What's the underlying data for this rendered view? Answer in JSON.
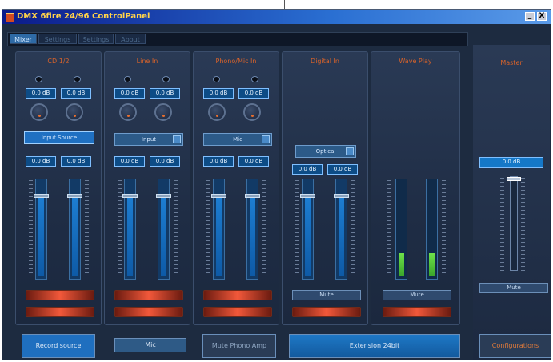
{
  "window": {
    "title": "DMX 6fire 24/96 ControlPanel",
    "minimize_label": "_",
    "close_label": "X"
  },
  "tabs": [
    {
      "label": "Mixer",
      "active": true
    },
    {
      "label": "Settings",
      "active": false
    },
    {
      "label": "Settings",
      "active": false
    },
    {
      "label": "About",
      "active": false
    }
  ],
  "strips": [
    {
      "name": "CD 1/2",
      "gain_left": "0.0 dB",
      "gain_right": "0.0 dB",
      "select": "Input Source",
      "level_left": "0.0 dB",
      "level_right": "0.0 dB",
      "fader_level": 0.85,
      "bottom_button": "Record source"
    },
    {
      "name": "Line In",
      "gain_left": "0.0 dB",
      "gain_right": "0.0 dB",
      "select": "Input",
      "level_left": "0.0 dB",
      "level_right": "0.0 dB",
      "fader_level": 0.85,
      "bottom_button": "Mic"
    },
    {
      "name": "Phono/Mic In",
      "gain_left": "0.0 dB",
      "gain_right": "0.0 dB",
      "select": "Mic",
      "level_left": "0.0 dB",
      "level_right": "0.0 dB",
      "fader_level": 0.85,
      "bottom_button": "Mute Phono Amp"
    },
    {
      "name": "Digital In",
      "select": "Optical",
      "level_left": "0.0 dB",
      "level_right": "0.0 dB",
      "fader_level": 0.85,
      "mute_label": "Mute",
      "bottom_button": "Extension 24bit"
    },
    {
      "name": "Wave Play",
      "meter_left": 0.25,
      "meter_right": 0.25,
      "mute_label": "Mute"
    }
  ],
  "master": {
    "name": "Master",
    "level": "0.0 dB",
    "fader_level": 1.0,
    "mute_label": "Mute",
    "bottom_button": "Configurations"
  }
}
